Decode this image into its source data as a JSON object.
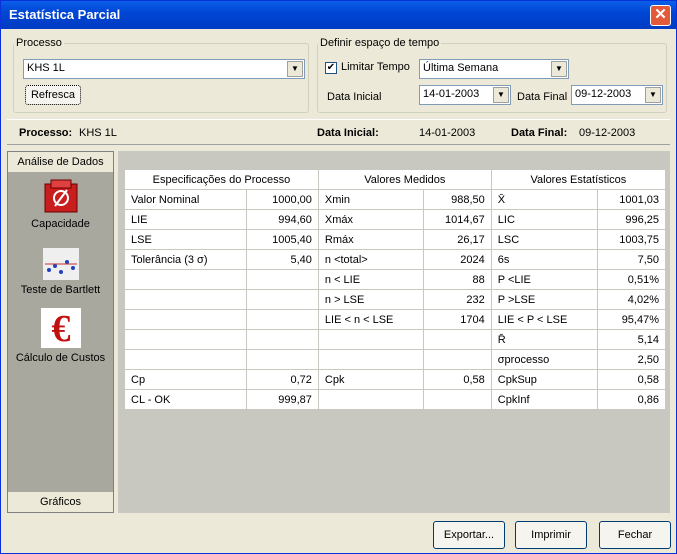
{
  "window": {
    "title": "Estatística Parcial"
  },
  "processo": {
    "legend": "Processo",
    "value": "KHS 1L",
    "refresh_label": "Refresca"
  },
  "tempo": {
    "legend": "Definir espaço de tempo",
    "checkbox_label": "Limitar Tempo",
    "checked": true,
    "period_value": "Última Semana",
    "data_inicial_label": "Data Inicial",
    "data_inicial_value": "14-01-2003",
    "data_final_label": "Data Final",
    "data_final_value": "09-12-2003"
  },
  "summary": {
    "processo_label": "Processo:",
    "processo_value": "KHS 1L",
    "data_inicial_label": "Data Inicial:",
    "data_inicial_value": "14-01-2003",
    "data_final_label": "Data Final:",
    "data_final_value": "09-12-2003"
  },
  "sidebar": {
    "top_tab": "Análise de Dados",
    "bottom_tab": "Gráficos",
    "items": [
      {
        "label": "Capacidade",
        "icon": "capacity-icon"
      },
      {
        "label": "Teste de Bartlett",
        "icon": "bartlett-icon"
      },
      {
        "label": "Cálculo de Custos",
        "icon": "euro-icon"
      }
    ]
  },
  "table": {
    "headers": [
      "Especificações do Processo",
      "Valores Medidos",
      "Valores Estatísticos"
    ],
    "rows": [
      [
        "Valor Nominal",
        "1000,00",
        "Xmin",
        "988,50",
        "X̄",
        "1001,03"
      ],
      [
        "LIE",
        "994,60",
        "Xmáx",
        "1014,67",
        "LIC",
        "996,25"
      ],
      [
        "LSE",
        "1005,40",
        "Rmáx",
        "26,17",
        "LSC",
        "1003,75"
      ],
      [
        "Tolerância (3 σ)",
        "5,40",
        "n <total>",
        "2024",
        "6s",
        "7,50"
      ],
      [
        "",
        "",
        "n < LIE",
        "88",
        "P <LIE",
        "0,51%"
      ],
      [
        "",
        "",
        "n > LSE",
        "232",
        "P >LSE",
        "4,02%"
      ],
      [
        "",
        "",
        "LIE < n < LSE",
        "1704",
        "LIE < P < LSE",
        "95,47%"
      ],
      [
        "",
        "",
        "",
        "",
        "R̄",
        "5,14"
      ],
      [
        "",
        "",
        "",
        "",
        "σprocesso",
        "2,50"
      ],
      [
        "Cp",
        "0,72",
        "Cpk",
        "0,58",
        "CpkSup",
        "0,58"
      ],
      [
        "CL - OK",
        "999,87",
        "",
        "",
        "CpkInf",
        "0,86"
      ]
    ]
  },
  "footer": {
    "export_label": "Exportar...",
    "print_label": "Imprimir",
    "close_label": "Fechar"
  }
}
